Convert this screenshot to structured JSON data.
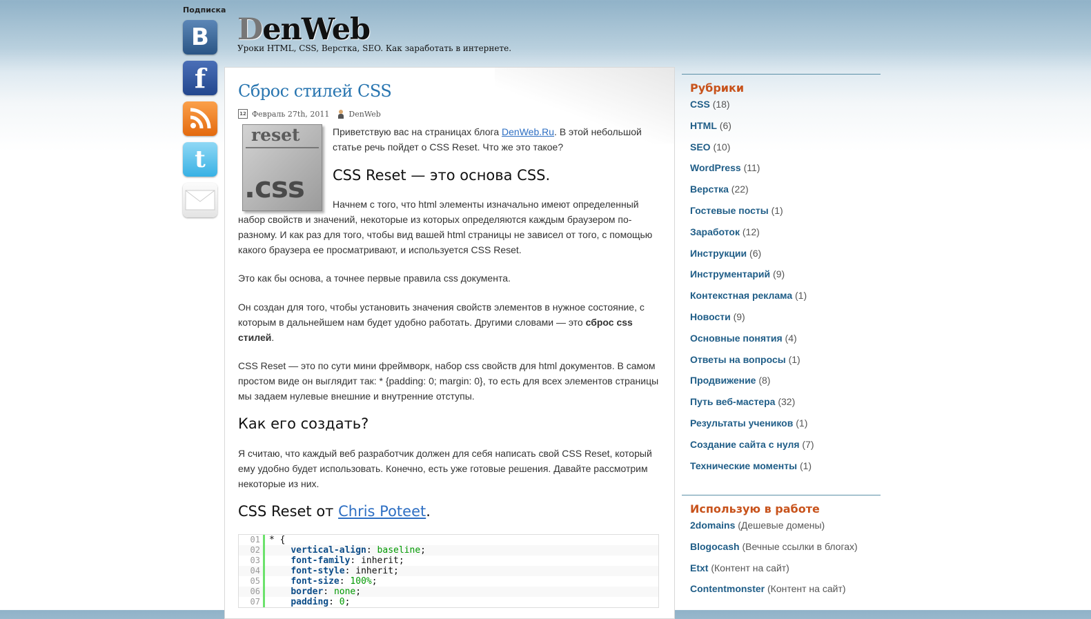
{
  "social": {
    "label": "Подписка",
    "icons": [
      {
        "name": "vkontakte-icon",
        "glyph": "B"
      },
      {
        "name": "facebook-icon",
        "glyph": "f"
      },
      {
        "name": "rss-icon",
        "glyph": ""
      },
      {
        "name": "twitter-icon",
        "glyph": "t"
      },
      {
        "name": "email-icon",
        "glyph": ""
      }
    ]
  },
  "header": {
    "logo_first": "D",
    "logo_rest": "enWeb",
    "tagline": "Уроки HTML, CSS, Верстка, SEO. Как заработать в интернете."
  },
  "post": {
    "title": "Сброс стилей CSS",
    "date": "Февраль 27th, 2011",
    "author": "DenWeb",
    "image_text_top": "reset",
    "image_text_bottom": ".css",
    "intro_before": "Приветствую вас на страницах блога ",
    "intro_link": "DenWeb.Ru",
    "intro_after": ". В этой небольшой статье речь пойдет о CSS Reset. Что же это такое?",
    "heading1": "CSS Reset — это основа CSS.",
    "p1": "Начнем с того, что html элементы изначально имеют определенный набор свойств и значений, некоторые из которых определяются каждым браузером по-разному. И как раз для того, чтобы вид вашей html страницы не зависел от того, с помощью какого браузера ее просматривают, и используется CSS Reset.",
    "p2": "Это как бы основа, а точнее первые правила css документа.",
    "p3_before": "Он создан для того, чтобы установить значения свойств элементов в нужное состояние, с которым в дальнейшем нам будет удобно работать. Другими словами — это ",
    "p3_bold": "сброс css стилей",
    "p3_after": ".",
    "p4": "CSS Reset — это по сути мини фреймворк, набор css свойств для html документов. В самом простом виде он выглядит так: * {padding: 0; margin: 0}, то есть для всех элементов страницы мы задаем нулевые внешние и внутренние отступы.",
    "heading2": "Как его создать?",
    "p5": "Я считаю, что каждый веб разработчик должен для себя написать свой CSS Reset, который ему удобно будет использовать. Конечно, есть уже готовые решения. Давайте рассмотрим некоторые из них.",
    "heading3_before": "CSS Reset от ",
    "heading3_link": "Chris Poteet",
    "heading3_after": ".",
    "code": [
      {
        "ln": "01",
        "text": "* {"
      },
      {
        "ln": "02",
        "prop": "vertical-align",
        "value": "baseline",
        "green": true
      },
      {
        "ln": "03",
        "prop": "font-family",
        "value": "inherit",
        "green": false
      },
      {
        "ln": "04",
        "prop": "font-style",
        "value": "inherit",
        "green": false
      },
      {
        "ln": "05",
        "prop": "font-size",
        "value": "100%",
        "green": true
      },
      {
        "ln": "06",
        "prop": "border",
        "value": "none",
        "green": true
      },
      {
        "ln": "07",
        "prop": "padding",
        "value": "0",
        "green": true
      }
    ]
  },
  "sidebar": {
    "rubrics_title": "Рубрики",
    "rubrics": [
      {
        "label": "CSS",
        "count": "(18)"
      },
      {
        "label": "HTML",
        "count": "(6)"
      },
      {
        "label": "SEO",
        "count": "(10)"
      },
      {
        "label": "WordPress",
        "count": "(11)"
      },
      {
        "label": "Верстка",
        "count": "(22)"
      },
      {
        "label": "Гостевые посты",
        "count": "(1)"
      },
      {
        "label": "Заработок",
        "count": "(12)"
      },
      {
        "label": "Инструкции",
        "count": "(6)"
      },
      {
        "label": "Инструментарий",
        "count": "(9)"
      },
      {
        "label": "Контекстная реклама",
        "count": "(1)"
      },
      {
        "label": "Новости",
        "count": "(9)"
      },
      {
        "label": "Основные понятия",
        "count": "(4)"
      },
      {
        "label": "Ответы на вопросы",
        "count": "(1)"
      },
      {
        "label": "Продвижение",
        "count": "(8)"
      },
      {
        "label": "Путь веб-мастера",
        "count": "(32)"
      },
      {
        "label": "Результаты учеников",
        "count": "(1)"
      },
      {
        "label": "Создание сайта с нуля",
        "count": "(7)"
      },
      {
        "label": "Технические моменты",
        "count": "(1)"
      }
    ],
    "tools_title": "Использую в работе",
    "tools": [
      {
        "label": "2domains",
        "note": "(Дешевые домены)"
      },
      {
        "label": "Blogocash",
        "note": "(Вечные ссылки в блогах)"
      },
      {
        "label": "Etxt",
        "note": "(Контент на сайт)"
      },
      {
        "label": "Contentmonster",
        "note": "(Контент на сайт)"
      }
    ]
  }
}
